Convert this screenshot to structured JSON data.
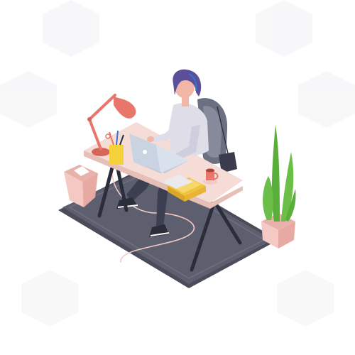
{
  "scene": {
    "colors": {
      "background": "#ffffff",
      "rug": "#5d5f6e",
      "rug_border": "#4a4c59",
      "desk_top": "#f6dcd6",
      "desk_edge": "#e6bfb6",
      "desk_legs": "#2b2d3a",
      "lamp": "#e8766b",
      "laptop": "#d9e1ec",
      "hair": "#5b4f9a",
      "sweater": "#dedde8",
      "pants": "#3c3e52",
      "skin": "#f1b6a6",
      "chair": "#6c6f80",
      "plant": "#6bbf48",
      "pot": "#f4c9c4",
      "bin": "#f4c9c4",
      "books": "#f0c33c",
      "cup": "#e8766b",
      "pencil_cup": "#f5d23a"
    },
    "objects": [
      "desk",
      "desk-lamp",
      "laptop",
      "person",
      "office-chair",
      "bag",
      "plant",
      "trash-bin",
      "books",
      "coffee-cup",
      "pencil-holder",
      "rug",
      "cable"
    ]
  }
}
